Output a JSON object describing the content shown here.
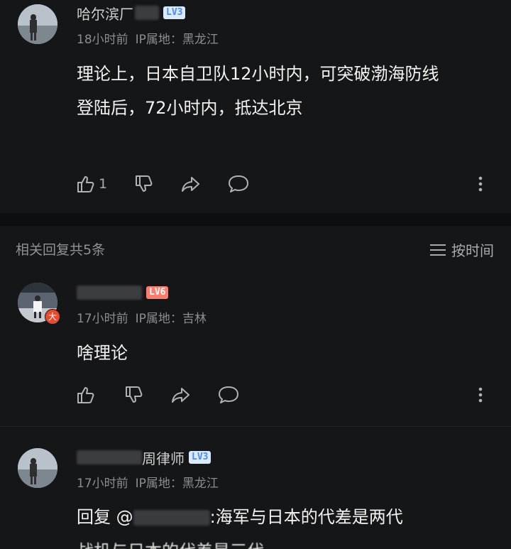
{
  "comments": [
    {
      "name": "哈尔滨厂",
      "level": "LV3",
      "time": "18小时前",
      "ip_label": "IP属地：",
      "ip_location": "黑龙江",
      "lines": [
        "理论上，日本自卫队12小时内，可突破渤海防线",
        "登陆后，72小时内，抵达北京"
      ],
      "like_count": "1",
      "icons": [
        "thumb-up-icon",
        "thumb-down-icon",
        "share-icon",
        "comment-icon",
        "more-icon"
      ]
    }
  ],
  "replies_header": {
    "count_text": "相关回复共5条",
    "sort_label": "按时间",
    "sort_icon": "sort-lines-icon"
  },
  "replies": [
    {
      "level": "LV6",
      "badge": "大",
      "time": "17小时前",
      "ip_label": "IP属地：",
      "ip_location": "吉林",
      "text": "啥理论"
    },
    {
      "name_suffix": "周律师",
      "level": "LV3",
      "time": "17小时前",
      "ip_label": "IP属地：",
      "ip_location": "黑龙江",
      "reply_prefix": "回复 @",
      "reply_text": ":海军与日本的代差是两代",
      "next_line_partial": "战机与日本的代差是三代"
    }
  ],
  "colors": {
    "background": "#151617",
    "level_blue_bg": "#dbe9ff",
    "level_blue_fg": "#4c8cf0",
    "level_red_bg": "#ff7b6d",
    "badge_orange": "#e84a2e"
  }
}
